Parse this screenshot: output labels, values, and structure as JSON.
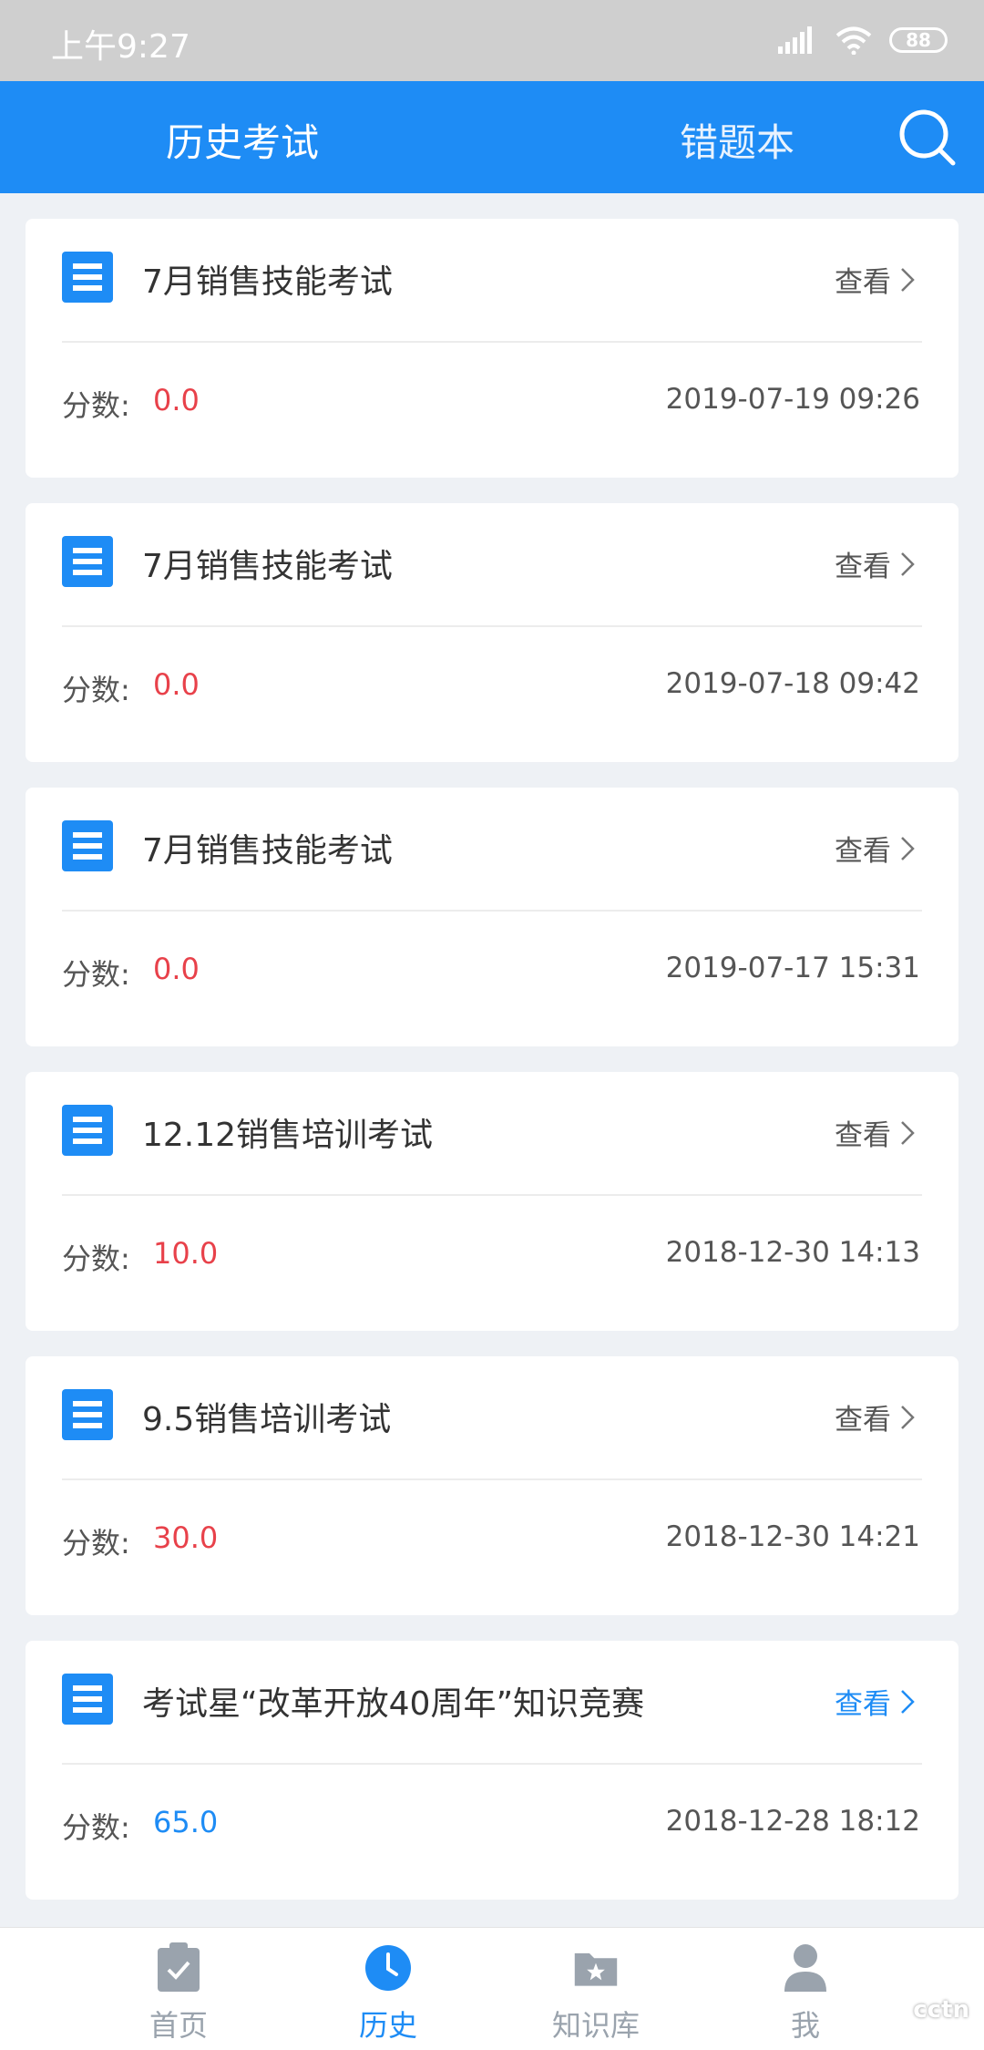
{
  "status": {
    "time": "上午9:27",
    "battery": "88"
  },
  "header": {
    "tab_history": "历史考试",
    "tab_wrong": "错题本"
  },
  "exams": [
    {
      "title": "7月销售技能考试",
      "view": "查看",
      "score_label": "分数:",
      "score": "0.0",
      "time": "2019-07-19 09:26"
    },
    {
      "title": "7月销售技能考试",
      "view": "查看",
      "score_label": "分数:",
      "score": "0.0",
      "time": "2019-07-18 09:42"
    },
    {
      "title": "7月销售技能考试",
      "view": "查看",
      "score_label": "分数:",
      "score": "0.0",
      "time": "2019-07-17 15:31"
    },
    {
      "title": "12.12销售培训考试",
      "view": "查看",
      "score_label": "分数:",
      "score": "10.0",
      "time": "2018-12-30 14:13"
    },
    {
      "title": "9.5销售培训考试",
      "view": "查看",
      "score_label": "分数:",
      "score": "30.0",
      "time": "2018-12-30 14:21"
    },
    {
      "title": "考试星“改革开放40周年”知识竞赛",
      "view": "查看",
      "score_label": "分数:",
      "score": "65.0",
      "time": "2018-12-28 18:12"
    }
  ],
  "nav": {
    "home": "首页",
    "history": "历史",
    "knowledge": "知识库",
    "me": "我"
  },
  "colors": {
    "primary": "#1e8cf5",
    "score_low": "#e8414a",
    "nav_inactive": "#9aa3ad"
  },
  "watermark": "cctn"
}
